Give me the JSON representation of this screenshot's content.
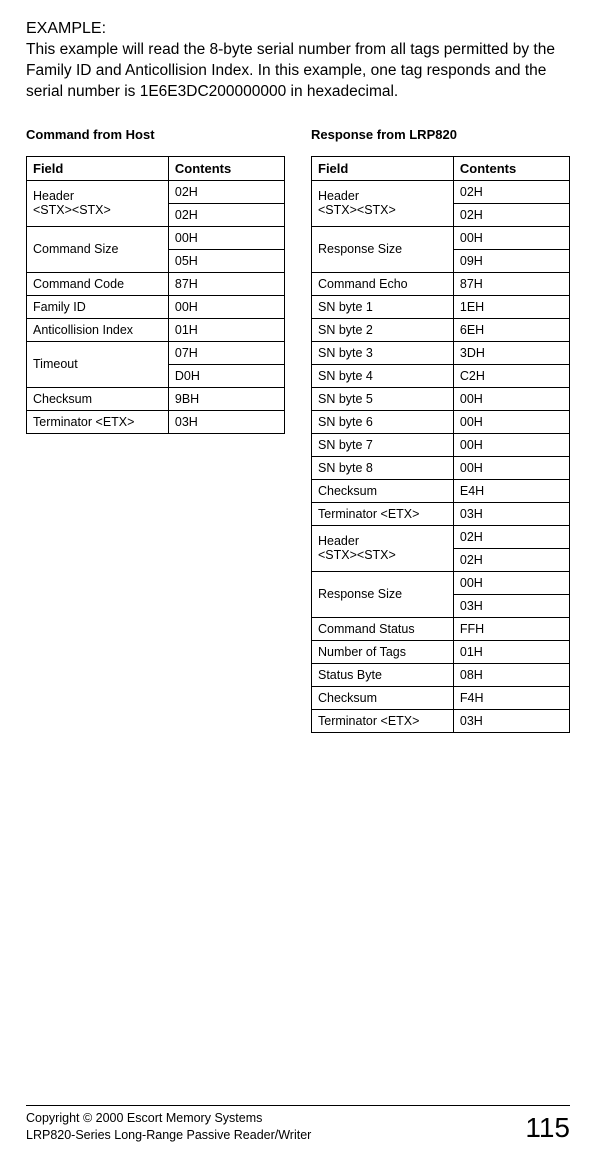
{
  "example": {
    "label": "EXAMPLE:",
    "text": "This example will read the 8-byte serial number from all tags permitted by the Family ID and Anticollision Index. In this example, one tag responds and the serial number is 1E6E3DC200000000 in hexadecimal."
  },
  "left_table": {
    "heading": "Command from Host",
    "headers": {
      "field": "Field",
      "contents": "Contents"
    },
    "rows": [
      {
        "field": "Header\n<STX><STX>",
        "contents": [
          "02H",
          "02H"
        ],
        "rowspan": 2
      },
      {
        "field": "Command Size",
        "contents": [
          "00H",
          "05H"
        ],
        "rowspan": 2
      },
      {
        "field": "Command Code",
        "contents": [
          "87H"
        ],
        "rowspan": 1
      },
      {
        "field": "Family ID",
        "contents": [
          "00H"
        ],
        "rowspan": 1
      },
      {
        "field": "Anticollision Index",
        "contents": [
          "01H"
        ],
        "rowspan": 1
      },
      {
        "field": "Timeout",
        "contents": [
          "07H",
          "D0H"
        ],
        "rowspan": 2
      },
      {
        "field": "Checksum",
        "contents": [
          "9BH"
        ],
        "rowspan": 1
      },
      {
        "field": "Terminator <ETX>",
        "contents": [
          "03H"
        ],
        "rowspan": 1
      }
    ]
  },
  "right_table": {
    "heading": "Response from LRP820",
    "headers": {
      "field": "Field",
      "contents": "Contents"
    },
    "rows": [
      {
        "field": "Header\n<STX><STX>",
        "contents": [
          "02H",
          "02H"
        ],
        "rowspan": 2
      },
      {
        "field": "Response Size",
        "contents": [
          "00H",
          "09H"
        ],
        "rowspan": 2
      },
      {
        "field": "Command Echo",
        "contents": [
          "87H"
        ],
        "rowspan": 1
      },
      {
        "field": "SN byte 1",
        "contents": [
          "1EH"
        ],
        "rowspan": 1
      },
      {
        "field": "SN byte 2",
        "contents": [
          "6EH"
        ],
        "rowspan": 1
      },
      {
        "field": "SN byte 3",
        "contents": [
          "3DH"
        ],
        "rowspan": 1
      },
      {
        "field": "SN byte 4",
        "contents": [
          "C2H"
        ],
        "rowspan": 1
      },
      {
        "field": "SN byte 5",
        "contents": [
          "00H"
        ],
        "rowspan": 1
      },
      {
        "field": "SN byte 6",
        "contents": [
          "00H"
        ],
        "rowspan": 1
      },
      {
        "field": "SN byte 7",
        "contents": [
          "00H"
        ],
        "rowspan": 1
      },
      {
        "field": "SN byte 8",
        "contents": [
          "00H"
        ],
        "rowspan": 1
      },
      {
        "field": "Checksum",
        "contents": [
          "E4H"
        ],
        "rowspan": 1
      },
      {
        "field": "Terminator <ETX>",
        "contents": [
          "03H"
        ],
        "rowspan": 1
      },
      {
        "field": "Header\n<STX><STX>",
        "contents": [
          "02H",
          "02H"
        ],
        "rowspan": 2
      },
      {
        "field": "Response Size",
        "contents": [
          "00H",
          "03H"
        ],
        "rowspan": 2
      },
      {
        "field": "Command Status",
        "contents": [
          "FFH"
        ],
        "rowspan": 1
      },
      {
        "field": "Number of Tags",
        "contents": [
          "01H"
        ],
        "rowspan": 1
      },
      {
        "field": "Status Byte",
        "contents": [
          "08H"
        ],
        "rowspan": 1
      },
      {
        "field": "Checksum",
        "contents": [
          "F4H"
        ],
        "rowspan": 1
      },
      {
        "field": "Terminator <ETX>",
        "contents": [
          "03H"
        ],
        "rowspan": 1
      }
    ]
  },
  "footer": {
    "copyright": "Copyright © 2000 Escort Memory Systems",
    "product": "LRP820-Series Long-Range Passive Reader/Writer",
    "page": "115"
  }
}
